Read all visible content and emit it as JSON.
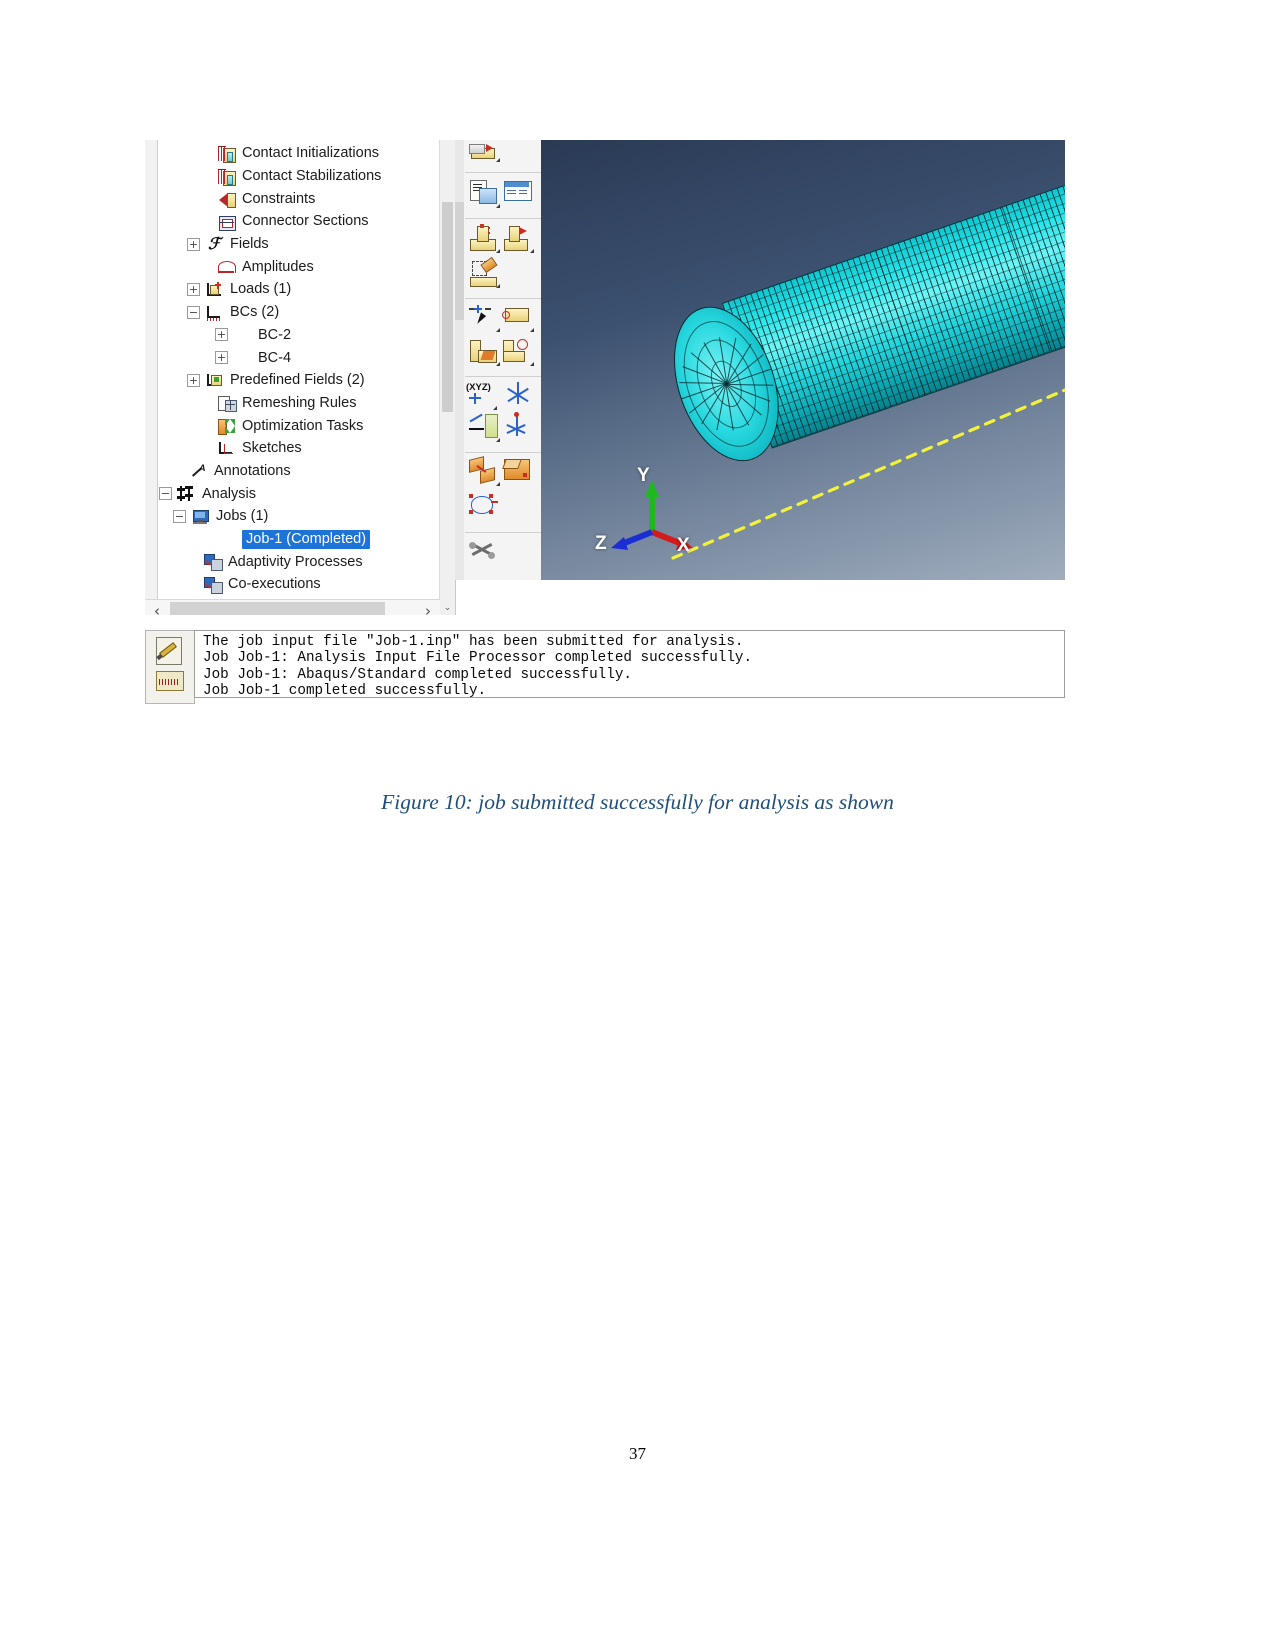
{
  "document": {
    "caption": "Figure 10:  job submitted successfully for analysis as shown",
    "page_number": "37",
    "caption_color": "#1f4e79"
  },
  "tree": {
    "panel_name": "Model Tree",
    "items": [
      {
        "label": "Contact Initializations",
        "indent": 3,
        "expander": "none",
        "icon": "contact-initializations-icon",
        "selected": false
      },
      {
        "label": "Contact Stabilizations",
        "indent": 3,
        "expander": "none",
        "icon": "contact-stabilizations-icon",
        "selected": false
      },
      {
        "label": "Constraints",
        "indent": 3,
        "expander": "none",
        "icon": "constraints-icon",
        "selected": false
      },
      {
        "label": "Connector Sections",
        "indent": 3,
        "expander": "none",
        "icon": "connector-sections-icon",
        "selected": false
      },
      {
        "label": "Fields",
        "indent": 2,
        "expander": "plus",
        "icon": "fields-icon",
        "selected": false
      },
      {
        "label": "Amplitudes",
        "indent": 3,
        "expander": "none",
        "icon": "amplitudes-icon",
        "selected": false
      },
      {
        "label": "Loads (1)",
        "indent": 2,
        "expander": "plus",
        "icon": "loads-icon",
        "selected": false
      },
      {
        "label": "BCs (2)",
        "indent": 2,
        "expander": "minus",
        "icon": "bcs-icon",
        "selected": false
      },
      {
        "label": "BC-2",
        "indent": 4,
        "expander": "plus",
        "icon": "none",
        "selected": false
      },
      {
        "label": "BC-4",
        "indent": 4,
        "expander": "plus",
        "icon": "none",
        "selected": false
      },
      {
        "label": "Predefined Fields (2)",
        "indent": 2,
        "expander": "plus",
        "icon": "predefined-fields-icon",
        "selected": false
      },
      {
        "label": "Remeshing Rules",
        "indent": 3,
        "expander": "none",
        "icon": "remeshing-rules-icon",
        "selected": false
      },
      {
        "label": "Optimization Tasks",
        "indent": 3,
        "expander": "none",
        "icon": "optimization-tasks-icon",
        "selected": false
      },
      {
        "label": "Sketches",
        "indent": 3,
        "expander": "none",
        "icon": "sketches-icon",
        "selected": false
      },
      {
        "label": "Annotations",
        "indent": 1,
        "expander": "none",
        "icon": "annotations-icon",
        "selected": false
      },
      {
        "label": "Analysis",
        "indent": 0,
        "expander": "minus",
        "icon": "analysis-icon",
        "selected": false
      },
      {
        "label": "Jobs (1)",
        "indent": 1,
        "expander": "minus",
        "icon": "jobs-icon",
        "selected": false
      },
      {
        "label": "Job-1 (Completed)",
        "indent": 3,
        "expander": "none",
        "icon": "none",
        "selected": true
      },
      {
        "label": "Adaptivity Processes",
        "indent": 2,
        "expander": "none",
        "icon": "adaptivity-processes-icon",
        "selected": false
      },
      {
        "label": "Co-executions",
        "indent": 2,
        "expander": "none",
        "icon": "co-executions-icon",
        "selected": false
      }
    ],
    "selection_color": "#1d74d6",
    "scrollbars": {
      "vertical_up": "▲",
      "vertical_down": "⌄",
      "horizontal_left": "‹",
      "horizontal_right": "›"
    }
  },
  "toolbar": {
    "name": "module-toolbox",
    "groups": [
      {
        "name": "partition-tools",
        "icons": [
          "partition-cell-icon"
        ]
      },
      {
        "name": "job-manager-tools",
        "icons": [
          "create-job-icon",
          "job-manager-icon"
        ]
      },
      {
        "name": "submit-tools",
        "icons": [
          "submit-job-icon",
          "continue-job-icon",
          "write-input-icon"
        ]
      },
      {
        "name": "query-tools",
        "icons": [
          "query-information-icon",
          "datum-icon",
          "partition-icon",
          "measure-icon"
        ]
      },
      {
        "name": "csys-tools",
        "icons": [
          "create-datum-csys-xyz-icon",
          "create-datum-csys-3points-icon",
          "datum-plane-icon",
          "datum-axis-icon"
        ]
      },
      {
        "name": "manipulate-tools",
        "icons": [
          "rotate-instance-icon",
          "translate-instance-icon",
          "ellipse-icon"
        ]
      },
      {
        "name": "tools-extra",
        "icons": [
          "tools-icon"
        ]
      }
    ]
  },
  "viewport": {
    "name": "3d-viewport",
    "triad": {
      "x_label": "X",
      "x_color": "#d41b1b",
      "y_label": "Y",
      "y_color": "#1fb81f",
      "z_label": "Z",
      "z_color": "#1b2ed4"
    },
    "model": {
      "description": "meshed cylinder",
      "mesh_color": "#2ad9e0",
      "edge_color": "#042c31",
      "axis_line_color": "#f2f23a"
    },
    "background_top": "#2a3a55",
    "background_bottom": "#9fadbd"
  },
  "message_log": {
    "name": "message-area",
    "lines": [
      "The job input file \"Job-1.inp\" has been submitted for analysis.",
      "Job Job-1: Analysis Input File Processor completed successfully.",
      "Job Job-1: Abaqus/Standard completed successfully.",
      "Job Job-1 completed successfully."
    ],
    "icons": [
      "message-pencil-icon",
      "keyboard-icon"
    ]
  }
}
